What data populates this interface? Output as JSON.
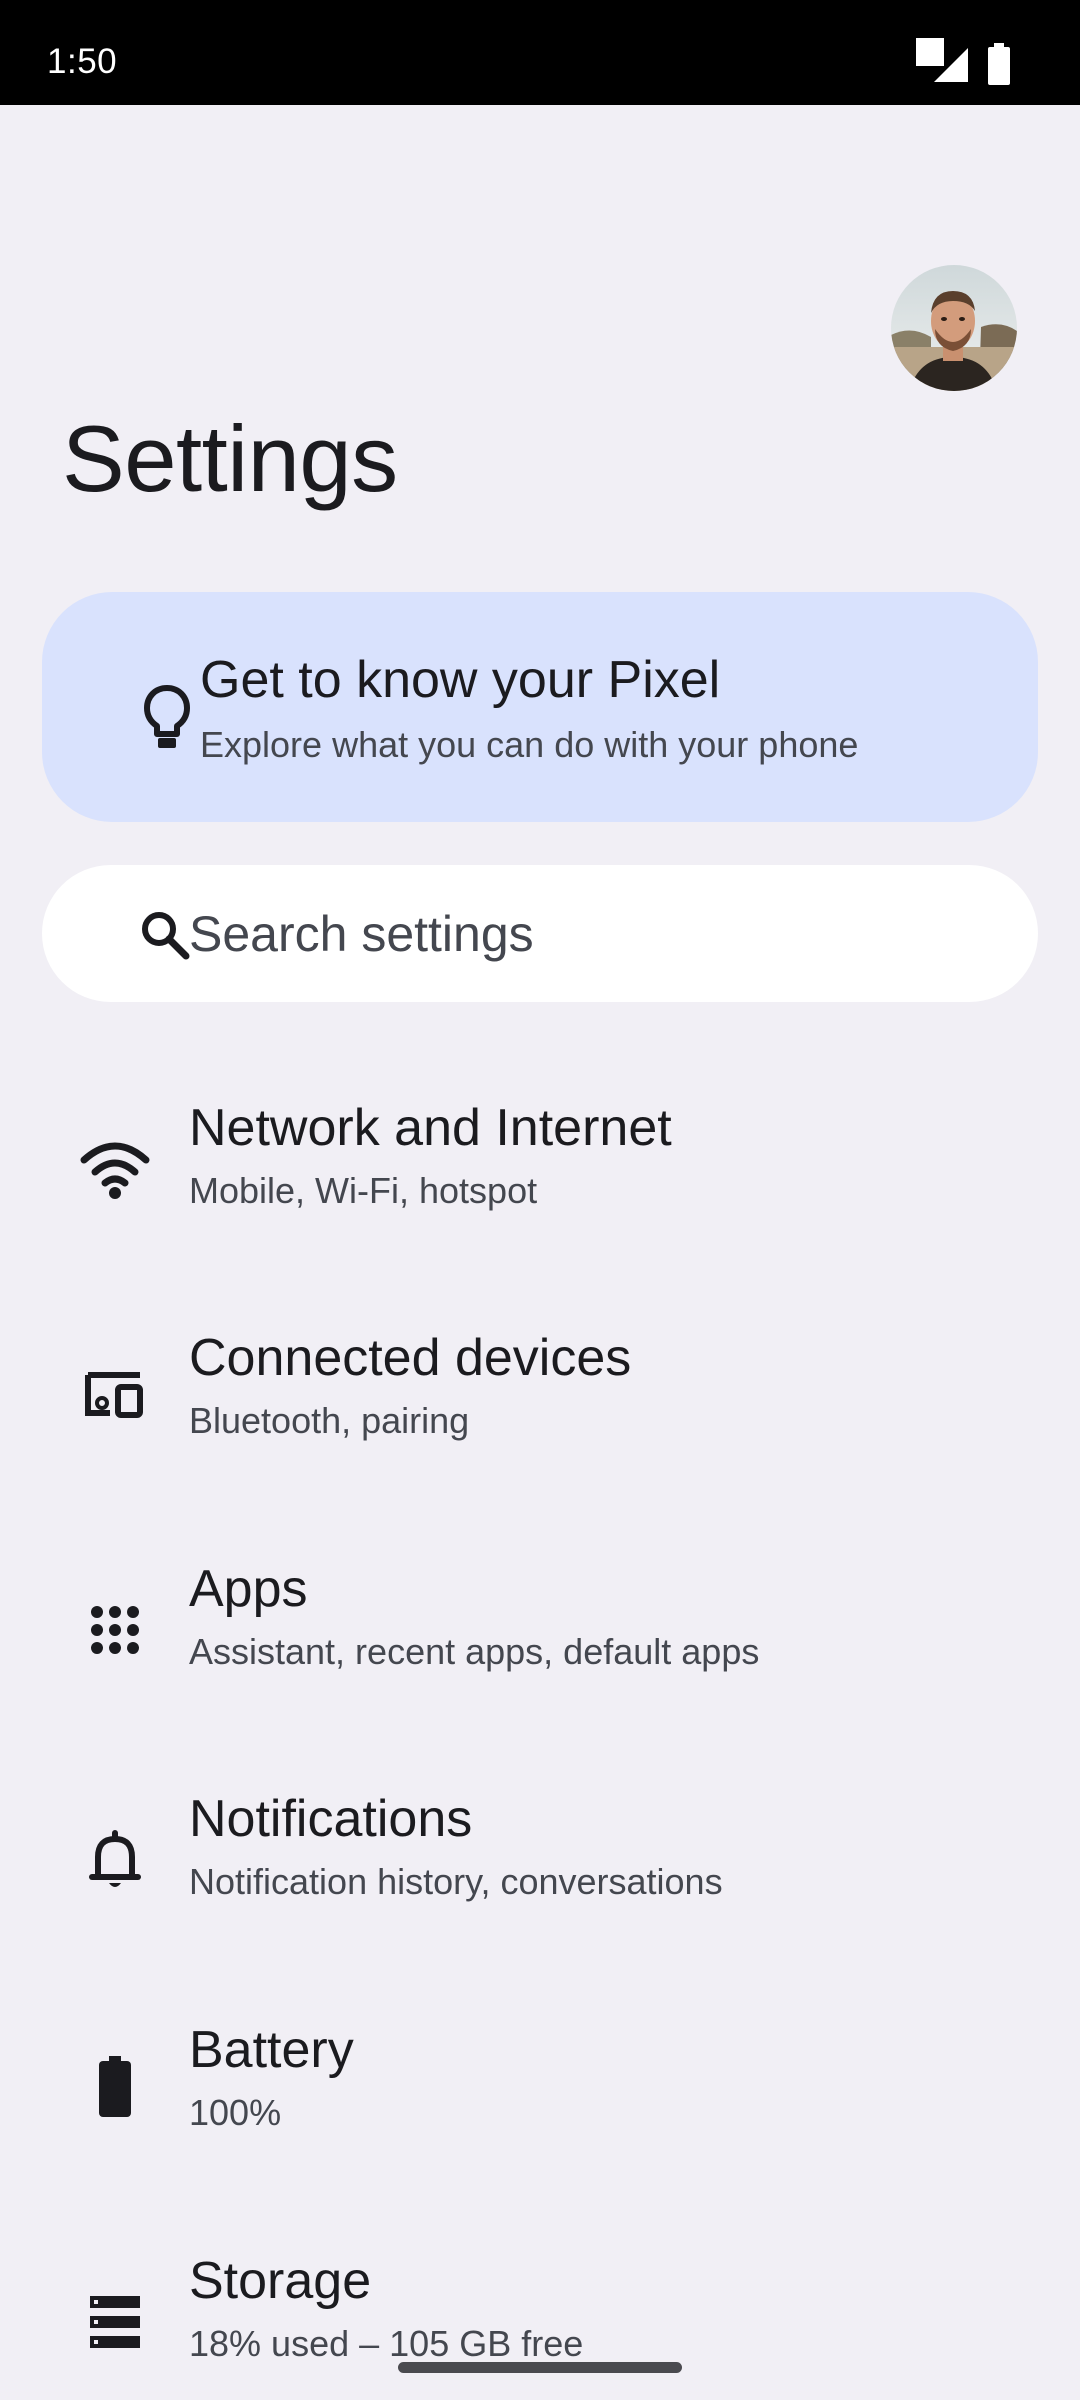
{
  "status_bar": {
    "time": "1:50",
    "icons": [
      "notification-square-icon",
      "cell-signal-icon",
      "battery-full-icon"
    ]
  },
  "header": {
    "title": "Settings",
    "avatar_icon": "profile-photo"
  },
  "tip_card": {
    "icon": "lightbulb-icon",
    "title": "Get to know your Pixel",
    "subtitle": "Explore what you can do with your phone",
    "background": "#d9e2fd"
  },
  "search": {
    "icon": "search-icon",
    "placeholder": "Search settings"
  },
  "items": [
    {
      "icon": "wifi-icon",
      "title": "Network and Internet",
      "subtitle": "Mobile, Wi-Fi, hotspot"
    },
    {
      "icon": "devices-icon",
      "title": "Connected devices",
      "subtitle": "Bluetooth, pairing"
    },
    {
      "icon": "apps-grid-icon",
      "title": "Apps",
      "subtitle": "Assistant, recent apps, default apps"
    },
    {
      "icon": "bell-icon",
      "title": "Notifications",
      "subtitle": "Notification history, conversations"
    },
    {
      "icon": "battery-icon",
      "title": "Battery",
      "subtitle": "100%"
    },
    {
      "icon": "storage-icon",
      "title": "Storage",
      "subtitle": "18% used – 105 GB free"
    }
  ],
  "colors": {
    "background": "#f1eff5",
    "card": "#d9e2fd",
    "search_background": "#ffffff",
    "text_primary": "#1b1b1f",
    "text_secondary": "#44474f"
  }
}
